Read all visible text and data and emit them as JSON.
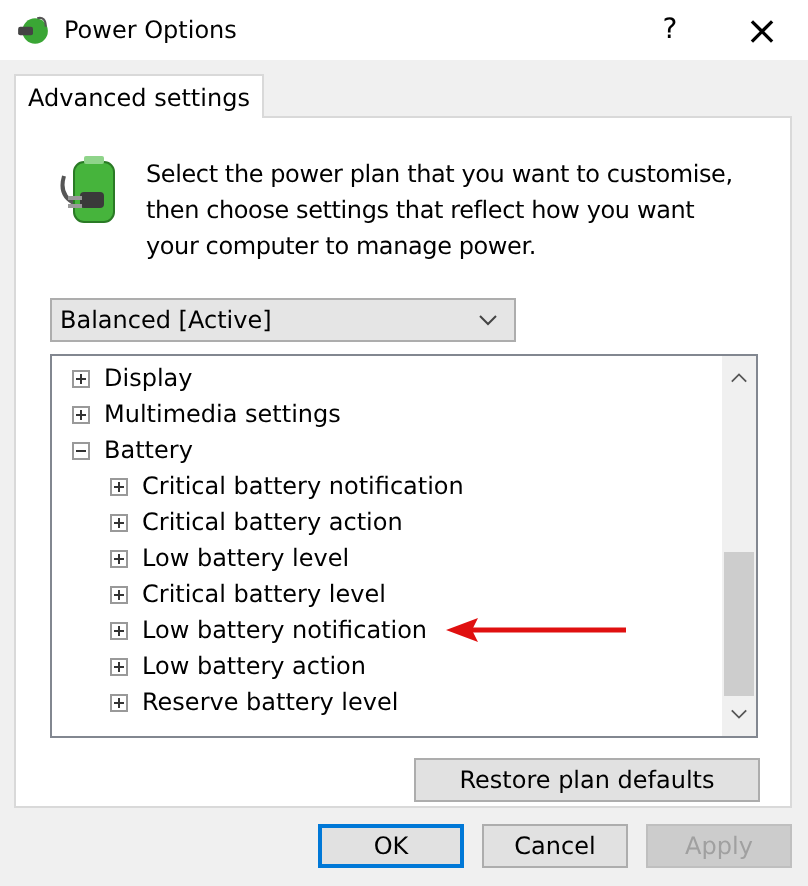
{
  "window": {
    "title": "Power Options",
    "help": "?",
    "close": "×"
  },
  "tabs": [
    {
      "label": "Advanced settings",
      "selected": true
    }
  ],
  "intro": "Select the power plan that you want to customise, then choose settings that reflect how you want your computer to manage power.",
  "plan_dropdown": {
    "value": "Balanced [Active]"
  },
  "tree": [
    {
      "label": "Display",
      "expanded": false
    },
    {
      "label": "Multimedia settings",
      "expanded": false
    },
    {
      "label": "Battery",
      "expanded": true,
      "children": [
        {
          "label": "Critical battery notification",
          "expanded": false
        },
        {
          "label": "Critical battery action",
          "expanded": false
        },
        {
          "label": "Low battery level",
          "expanded": false
        },
        {
          "label": "Critical battery level",
          "expanded": false
        },
        {
          "label": "Low battery notification",
          "expanded": false,
          "highlighted": true
        },
        {
          "label": "Low battery action",
          "expanded": false
        },
        {
          "label": "Reserve battery level",
          "expanded": false
        }
      ]
    }
  ],
  "restore_button": "Restore plan defaults",
  "buttons": [
    {
      "label": "OK",
      "default": true,
      "disabled": false
    },
    {
      "label": "Cancel",
      "default": false,
      "disabled": false
    },
    {
      "label": "Apply",
      "default": false,
      "disabled": true
    }
  ]
}
